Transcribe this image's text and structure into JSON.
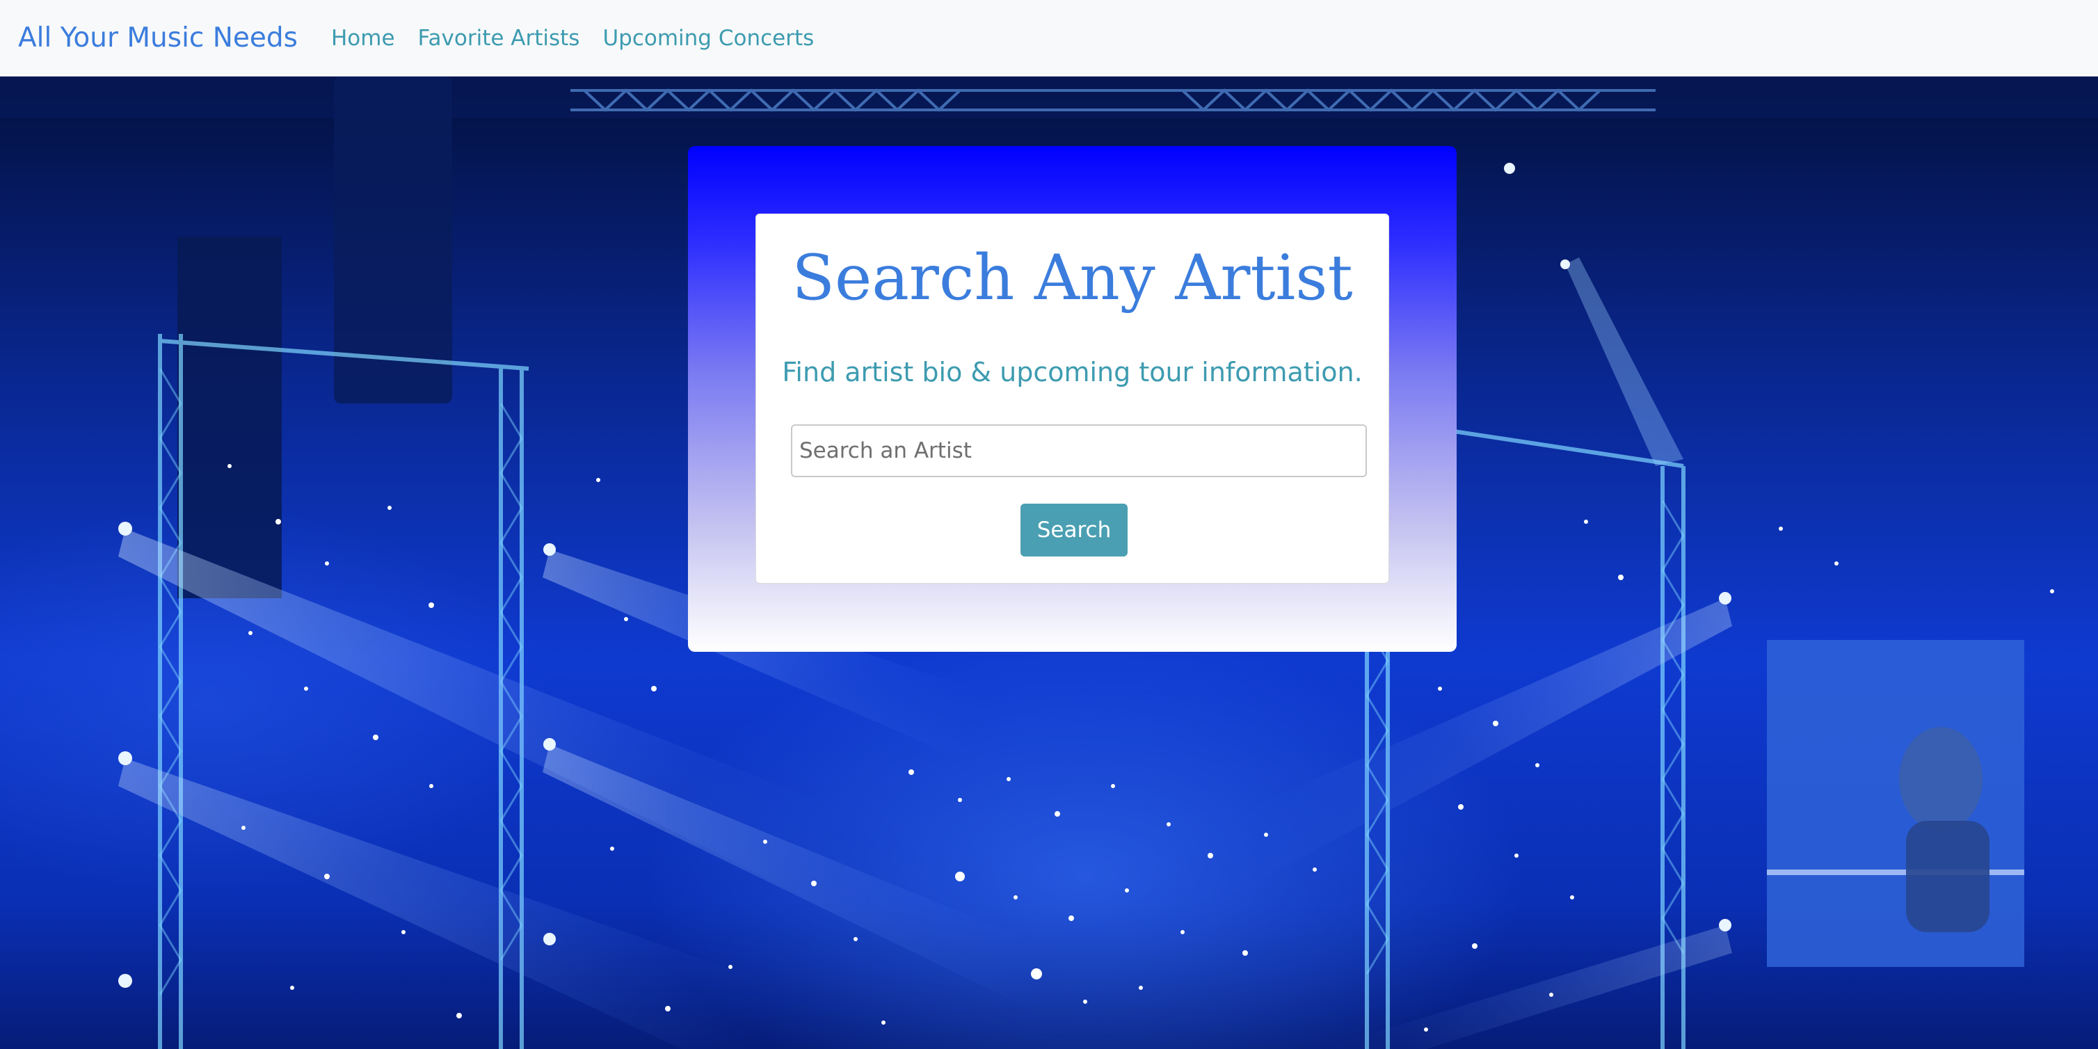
{
  "navbar": {
    "brand": "All Your Music Needs",
    "links": [
      "Home",
      "Favorite Artists",
      "Upcoming Concerts"
    ]
  },
  "search": {
    "title": "Search Any Artist",
    "subtitle": "Find artist bio & upcoming tour information.",
    "placeholder": "Search an Artist",
    "value": "",
    "button_label": "Search"
  },
  "colors": {
    "brand": "#3b7ddd",
    "nav_link": "#3d9bb0",
    "button": "#4a9fb2",
    "card_gradient_top": "#0000ff"
  }
}
